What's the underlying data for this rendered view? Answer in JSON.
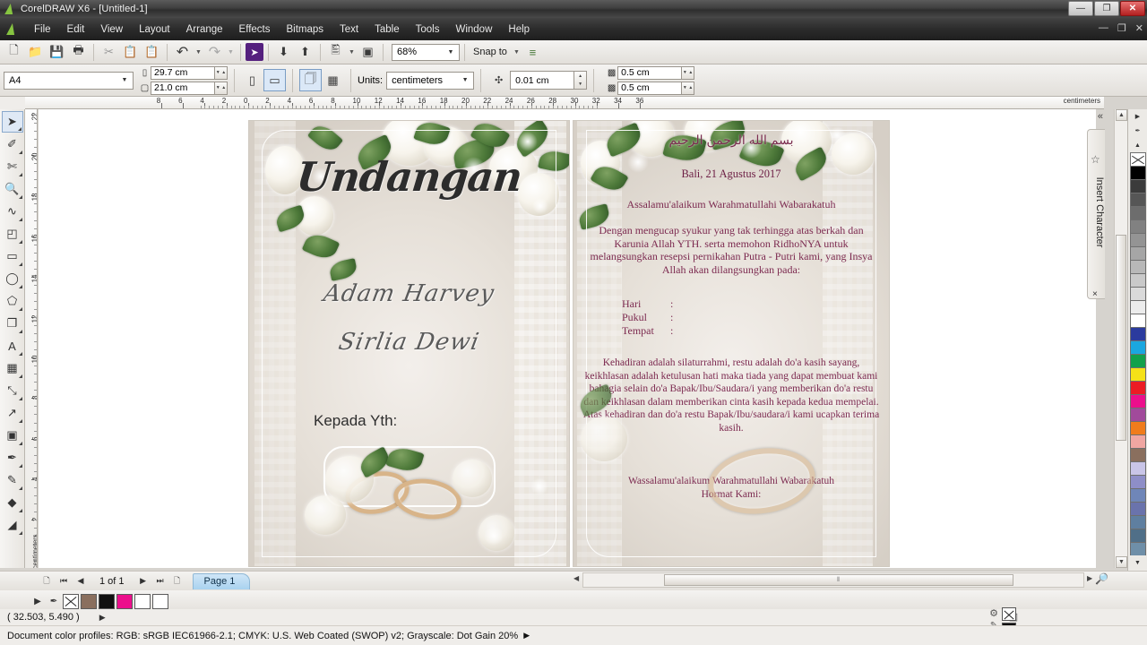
{
  "window": {
    "title": "CorelDRAW X6 - [Untitled-1]",
    "app_name": "CorelDRAW X6",
    "document_name": "[Untitled-1]",
    "minimize_label": "—",
    "maximize_label": "❐",
    "close_label": "✕",
    "doc_minimize_label": "—",
    "doc_restore_label": "❐",
    "doc_close_label": "✕"
  },
  "menubar": {
    "items": [
      {
        "label": "File",
        "accel": "F"
      },
      {
        "label": "Edit",
        "accel": "E"
      },
      {
        "label": "View",
        "accel": "V"
      },
      {
        "label": "Layout",
        "accel": "L"
      },
      {
        "label": "Arrange",
        "accel": "A"
      },
      {
        "label": "Effects",
        "accel": "c"
      },
      {
        "label": "Bitmaps",
        "accel": "B"
      },
      {
        "label": "Text",
        "accel": "x"
      },
      {
        "label": "Table",
        "accel": "T"
      },
      {
        "label": "Tools",
        "accel": "o"
      },
      {
        "label": "Window",
        "accel": "W"
      },
      {
        "label": "Help",
        "accel": "H"
      }
    ]
  },
  "standard_toolbar": {
    "buttons": [
      {
        "name": "new-document",
        "glyph": "🗋"
      },
      {
        "name": "open-document",
        "glyph": "📂"
      },
      {
        "name": "save-document",
        "glyph": "💾"
      },
      {
        "name": "print-document",
        "glyph": "🖨"
      },
      {
        "name": "cut",
        "glyph": "✂"
      },
      {
        "name": "copy",
        "glyph": "❐"
      },
      {
        "name": "paste",
        "glyph": "📋"
      },
      {
        "name": "undo",
        "glyph": "↶"
      },
      {
        "name": "redo",
        "glyph": "↷"
      },
      {
        "name": "import",
        "glyph": "⬇"
      },
      {
        "name": "export",
        "glyph": "⬆"
      },
      {
        "name": "publish-to-pdf",
        "glyph": "🗎"
      },
      {
        "name": "application-launcher",
        "glyph": "▣"
      }
    ],
    "zoom_level": "68%",
    "snap_to_label": "Snap to",
    "options_label": "Options"
  },
  "property_bar": {
    "paper_type": "A4",
    "page_width": "29.7 cm",
    "page_height": "21.0 cm",
    "orientation_portrait": "Portrait",
    "orientation_landscape": "Landscape",
    "all_pages_label": "All Pages",
    "current_page_label": "Current Page",
    "units_label": "Units:",
    "units_value": "centimeters",
    "nudge_offset": "0.01 cm",
    "duplicate_x": "0.5 cm",
    "duplicate_y": "0.5 cm"
  },
  "rulers": {
    "unit_label": "centimeters",
    "horizontal_ticks": [
      8,
      6,
      4,
      2,
      0,
      2,
      4,
      6,
      8,
      10,
      12,
      14,
      16,
      18,
      20,
      22,
      24,
      26,
      28,
      30,
      32,
      34,
      36
    ],
    "vertical_ticks": [
      22,
      20,
      18,
      16,
      14,
      12,
      10,
      8,
      6,
      4,
      2
    ]
  },
  "toolbox": {
    "tools": [
      {
        "name": "pick-tool",
        "glyph": "➤",
        "selected": true
      },
      {
        "name": "shape-tool",
        "glyph": "✐",
        "selected": false
      },
      {
        "name": "crop-tool",
        "glyph": "✄",
        "selected": false
      },
      {
        "name": "zoom-tool",
        "glyph": "🔍",
        "selected": false
      },
      {
        "name": "freehand-tool",
        "glyph": "∿",
        "selected": false
      },
      {
        "name": "smart-fill-tool",
        "glyph": "◰",
        "selected": false
      },
      {
        "name": "rectangle-tool",
        "glyph": "▭",
        "selected": false
      },
      {
        "name": "ellipse-tool",
        "glyph": "◯",
        "selected": false
      },
      {
        "name": "polygon-tool",
        "glyph": "⬠",
        "selected": false
      },
      {
        "name": "basic-shapes-tool",
        "glyph": "❐",
        "selected": false
      },
      {
        "name": "text-tool",
        "glyph": "A",
        "selected": false
      },
      {
        "name": "table-tool",
        "glyph": "▦",
        "selected": false
      },
      {
        "name": "parallel-dimension-tool",
        "glyph": "⤡",
        "selected": false
      },
      {
        "name": "straight-line-connector",
        "glyph": "↗",
        "selected": false
      },
      {
        "name": "blend-tool",
        "glyph": "▣",
        "selected": false
      },
      {
        "name": "color-eyedropper-tool",
        "glyph": "✒",
        "selected": false
      },
      {
        "name": "outline-pen-tool",
        "glyph": "✎",
        "selected": false
      },
      {
        "name": "fill-tool",
        "glyph": "◆",
        "selected": false
      },
      {
        "name": "interactive-fill-tool",
        "glyph": "◢",
        "selected": false
      }
    ]
  },
  "docker": {
    "title": "Insert Character",
    "collapse_glyph": "«",
    "close_glyph": "×",
    "pin_glyph": "☆"
  },
  "palette": {
    "no_color_label": "No Color",
    "scroll_up": "▲",
    "scroll_down": "▼",
    "expand": "◀",
    "colors": [
      "#000000",
      "#3b3b3b",
      "#565656",
      "#6d6d6d",
      "#818181",
      "#949494",
      "#a6a6a6",
      "#b8b8b8",
      "#c9c9c9",
      "#dadada",
      "#ececec",
      "#ffffff",
      "#2b3b9e",
      "#1aa7e0",
      "#12a14b",
      "#f5e118",
      "#ec1c24",
      "#ec0f8c",
      "#a14a9b",
      "#f07c1c",
      "#f0a6a2",
      "#8a6f5e",
      "#c9c5e8",
      "#8e8ec8",
      "#6f86b8",
      "#6a73ac",
      "#5f7fa0",
      "#506f88",
      "#6f8fa8"
    ]
  },
  "document": {
    "left_page": {
      "heading": "Undangan",
      "groom_name": "Adam Harvey",
      "bride_name": "Sirlia Dewi",
      "recipient_label": "Kepada Yth:"
    },
    "right_page": {
      "basmala": "بسم الله الرحمن الرحيم",
      "place_date": "Bali, 21 Agustus 2017",
      "greeting": "Assalamu'alaikum Warahmatullahi Wabarakatuh",
      "body_1": "Dengan mengucap syukur yang tak terhingga atas berkah dan Karunia Allah YTH. serta memohon RidhoNYA untuk melangsungkan resepsi pernikahan Putra - Putri kami, yang Insya Allah akan dilangsungkan pada:",
      "details": [
        {
          "label": "Hari",
          "separator": ":",
          "value": ""
        },
        {
          "label": "Pukul",
          "separator": ":",
          "value": ""
        },
        {
          "label": "Tempat",
          "separator": ":",
          "value": ""
        }
      ],
      "body_2": "Kehadiran adalah silaturrahmi, restu adalah do'a kasih sayang, keikhlasan adalah ketulusan hati maka tiada yang dapat membuat kami bahagia selain do'a Bapak/Ibu/Saudara/i yang memberikan do'a restu dan keikhlasan dalam memberikan cinta kasih kepada kedua mempelai. Atas kehadiran dan do'a restu Bapak/Ibu/saudara/i kami ucapkan terima kasih.",
      "closing_1": "Wassalamu'alaikum Warahmatullahi Wabarakatuh",
      "closing_2": "Hormat Kami:"
    }
  },
  "page_navigator": {
    "add_page_start": "+",
    "first_page": "⏮",
    "previous_page": "◀",
    "page_counter": "1 of 1",
    "next_page": "▶",
    "last_page": "⏭",
    "add_page_end": "+",
    "active_page_tab": "Page 1"
  },
  "status_bar": {
    "coordinates": "( 32.503, 5.490 )",
    "coordinates_more": "▶",
    "color_profiles": "Document color profiles: RGB: sRGB IEC61966-2.1; CMYK: U.S. Web Coated (SWOP) v2; Grayscale: Dot Gain 20%",
    "color_profiles_more": "▶",
    "fill_label": "Fill",
    "outline_label": "Outline",
    "fill_value": "none",
    "outline_value": "#111111"
  },
  "color_strip": {
    "swatches": [
      "#8a6f5e",
      "#111111",
      "#ec0f8c",
      "#ffffff",
      "#ffffff"
    ],
    "eyedropper_glyph": "✒",
    "play_glyph": "▶"
  },
  "scrollbars": {
    "horizontal_left": "◀",
    "horizontal_right": "▶",
    "vertical_up": "▲",
    "vertical_down": "▼",
    "zoom_glyph": "🔎",
    "grip": "⫴"
  }
}
